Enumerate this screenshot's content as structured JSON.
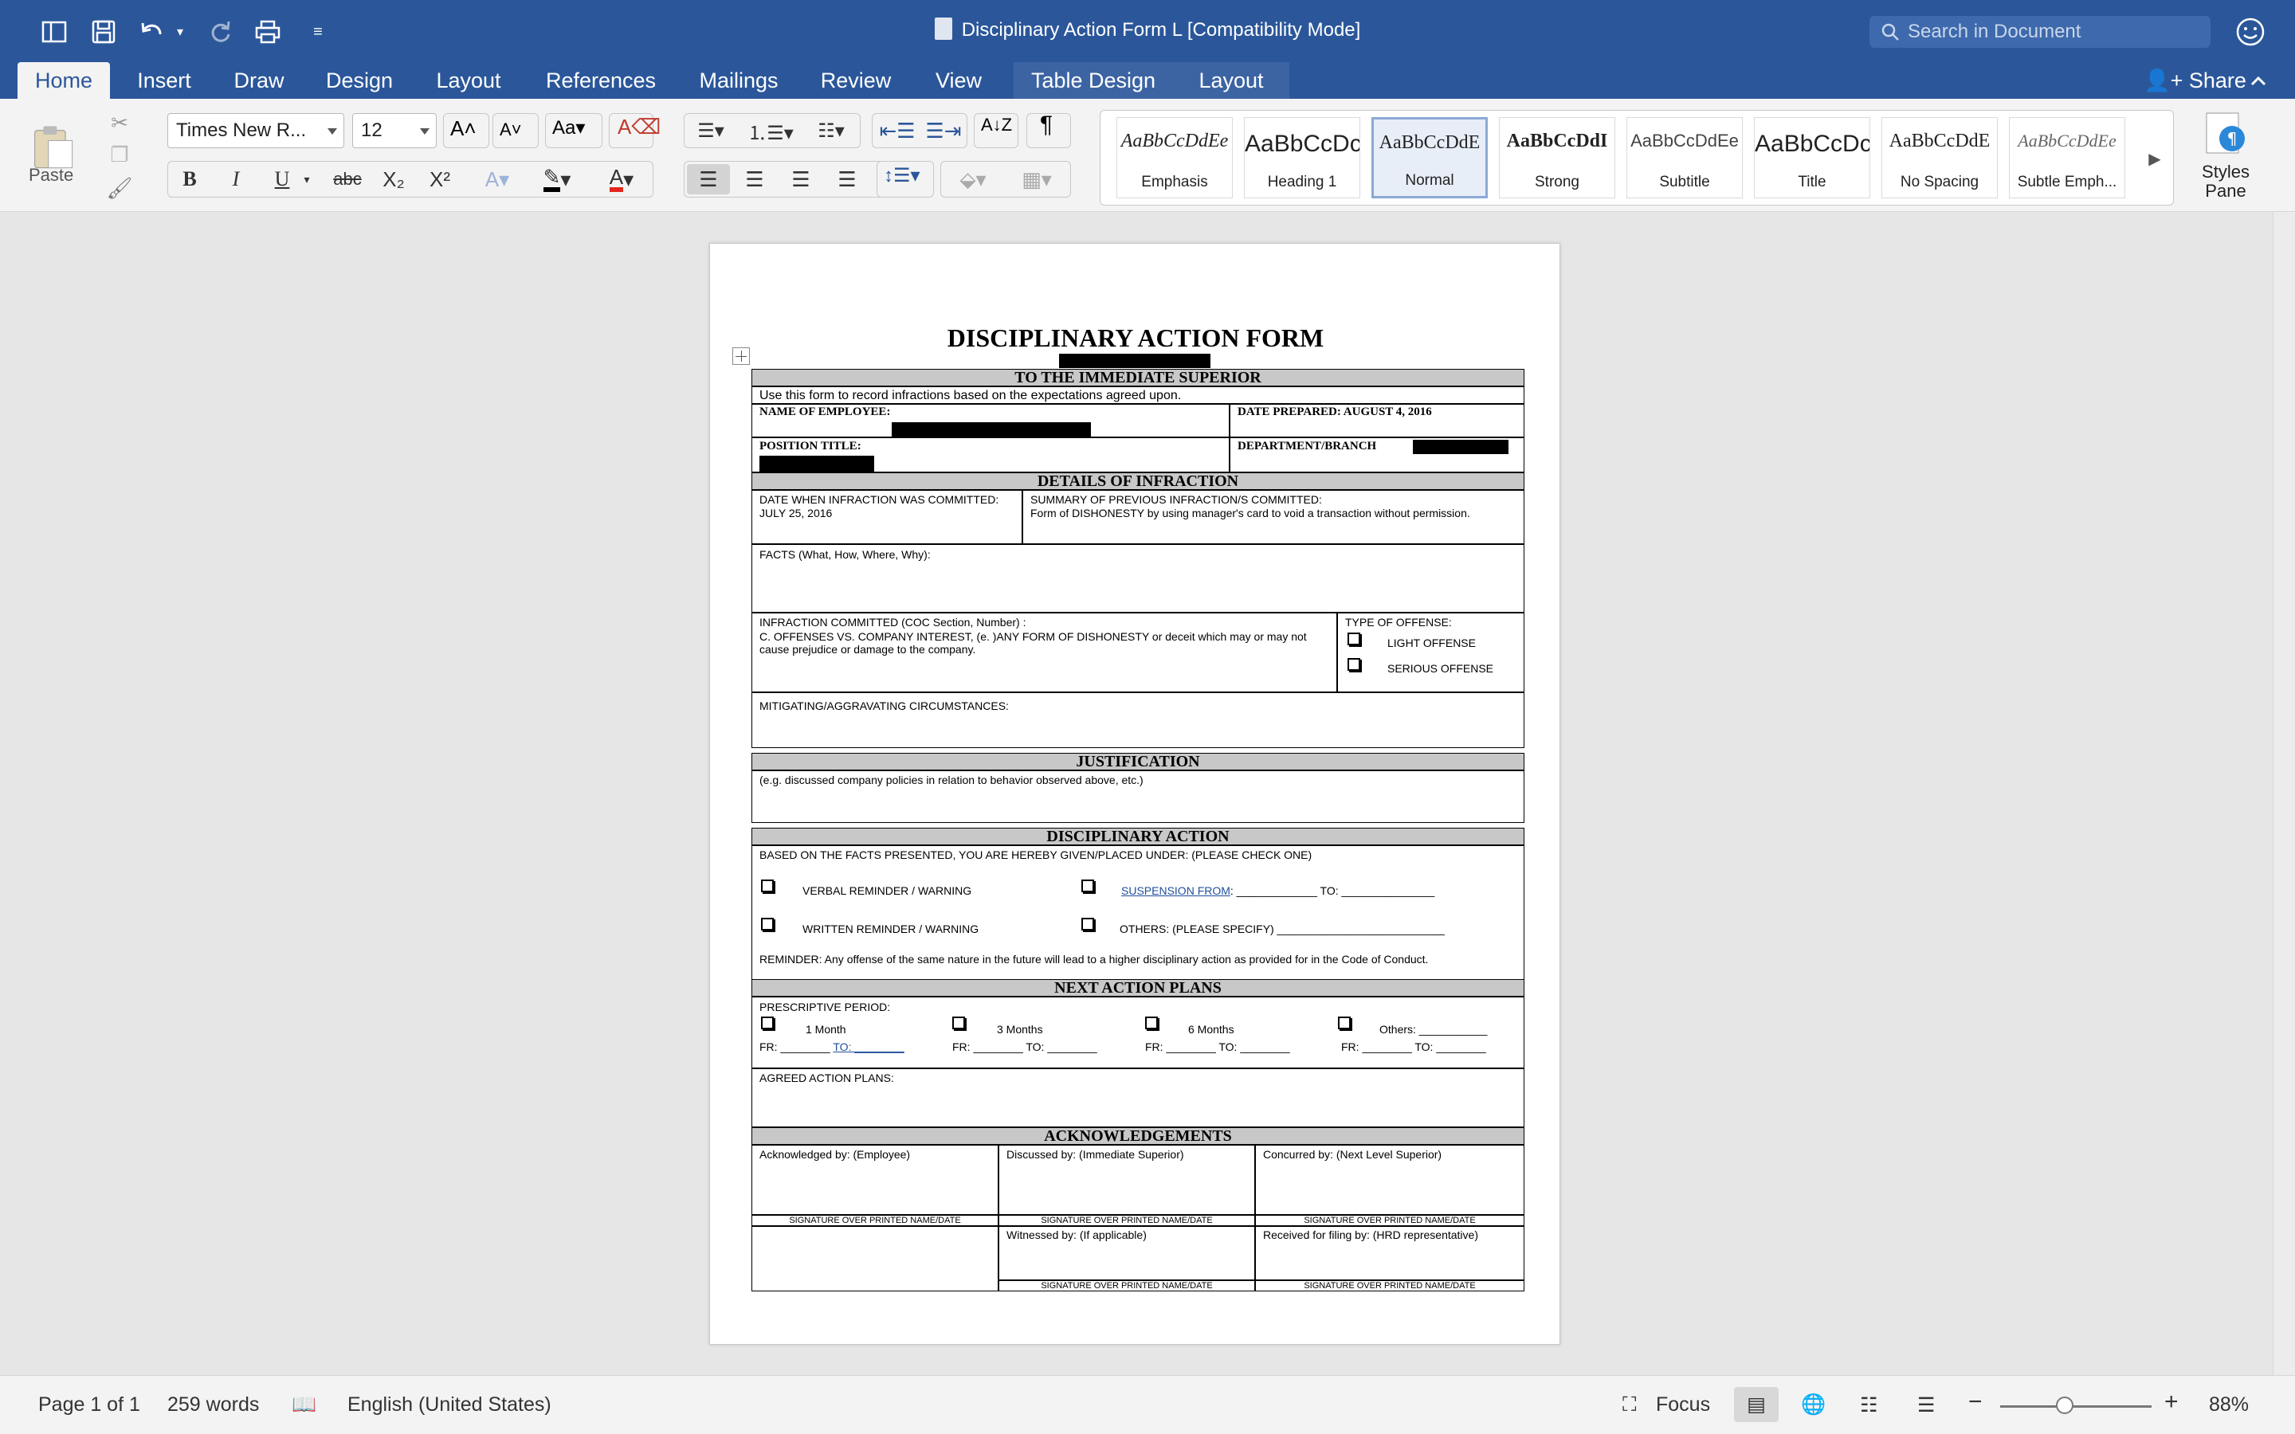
{
  "window": {
    "title": "Disciplinary Action Form L [Compatibility Mode]",
    "search_placeholder": "Search in Document"
  },
  "tabs": [
    {
      "label": "Home"
    },
    {
      "label": "Insert"
    },
    {
      "label": "Draw"
    },
    {
      "label": "Design"
    },
    {
      "label": "Layout"
    },
    {
      "label": "References"
    },
    {
      "label": "Mailings"
    },
    {
      "label": "Review"
    },
    {
      "label": "View"
    },
    {
      "label": "Table Design"
    },
    {
      "label": "Layout"
    }
  ],
  "share_label": "Share",
  "ribbon": {
    "paste_label": "Paste",
    "font_name": "Times New R...",
    "font_size": "12",
    "styles_pane_label": "Styles Pane",
    "styles": [
      {
        "name": "Emphasis",
        "sample": "AaBbCcDdEe"
      },
      {
        "name": "Heading 1",
        "sample": "AaBbCcDc"
      },
      {
        "name": "Normal",
        "sample": "AaBbCcDdE"
      },
      {
        "name": "Strong",
        "sample": "AaBbCcDdI"
      },
      {
        "name": "Subtitle",
        "sample": "AaBbCcDdEe"
      },
      {
        "name": "Title",
        "sample": "AaBbCcDc"
      },
      {
        "name": "No Spacing",
        "sample": "AaBbCcDdE"
      },
      {
        "name": "Subtle Emph...",
        "sample": "AaBbCcDdEe"
      }
    ]
  },
  "form": {
    "title": "DISCIPLINARY ACTION FORM",
    "sec_superior": "TO THE IMMEDIATE SUPERIOR",
    "intro": "Use this form to record infractions based on the expectations agreed upon.",
    "name_label": "NAME OF EMPLOYEE:",
    "date_prepared": "DATE PREPARED: AUGUST 4, 2016",
    "position_label": "POSITION TITLE:",
    "dept_label": "DEPARTMENT/BRANCH",
    "sec_details": "DETAILS OF INFRACTION",
    "date_committed_label": "DATE WHEN INFRACTION WAS COMMITTED:",
    "date_committed": "JULY 25, 2016",
    "summary_label": "SUMMARY OF PREVIOUS INFRACTION/S COMMITTED:",
    "summary_text": "Form of DISHONESTY by using manager's card to void a transaction without permission.",
    "facts_label": "FACTS (What, How, Where, Why):",
    "infraction_label": "INFRACTION COMMITTED (COC Section, Number) :",
    "infraction_text": "C. OFFENSES VS. COMPANY INTEREST, (e. )ANY FORM OF DISHONESTY  or deceit which may or may not cause prejudice or damage to the company.",
    "type_label": "TYPE OF OFFENSE:",
    "light_offense": "LIGHT OFFENSE",
    "serious_offense": "SERIOUS OFFENSE",
    "mitigating_label": "MITIGATING/AGGRAVATING CIRCUMSTANCES:",
    "sec_justification": "JUSTIFICATION",
    "justification_hint": "(e.g. discussed company policies in relation to behavior observed above, etc.)",
    "sec_disciplinary": "DISCIPLINARY ACTION",
    "based_text": "BASED ON THE FACTS PRESENTED, YOU ARE HEREBY GIVEN/PLACED UNDER: (PLEASE CHECK ONE)",
    "verbal": "VERBAL REMINDER / WARNING",
    "written": "WRITTEN REMINDER / WARNING",
    "suspension": "SUSPENSION  FROM",
    "suspension_rest": ": _____________  TO: _______________",
    "others_specify": "OTHERS: (PLEASE SPECIFY) ___________________________",
    "reminder": "REMINDER: Any offense of the same nature in the future will lead to a higher disciplinary action as provided for in the Code of Conduct.",
    "sec_next": "NEXT ACTION PLANS",
    "prescriptive": "PRESCRIPTIVE PERIOD:",
    "p1": "1 Month",
    "p3": "3 Months",
    "p6": "6 Months",
    "pothers": "Others: ___________",
    "fr1": "FR: ________",
    "to1": "TO: ________",
    "fr_to": "FR: ________ TO: ________",
    "agreed": "AGREED ACTION PLANS:",
    "sec_ack": "ACKNOWLEDGEMENTS",
    "ack_employee": "Acknowledged by: (Employee)",
    "ack_discussed": "Discussed by: (Immediate Superior)",
    "ack_concurred": "Concurred by: (Next Level Superior)",
    "ack_witnessed": "Witnessed by: (If applicable)",
    "ack_received": "Received for filing by: (HRD representative)",
    "sig": "SIGNATURE OVER PRINTED NAME/DATE"
  },
  "status": {
    "page": "Page 1 of 1",
    "words": "259 words",
    "language": "English (United States)",
    "focus": "Focus",
    "zoom": "88%"
  }
}
